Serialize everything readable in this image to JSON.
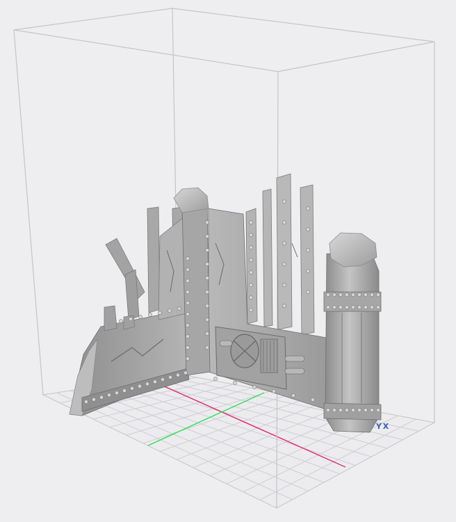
{
  "viewport": {
    "background": "#eeeef0",
    "build_volume_color": "#c4c4c8",
    "grid_color": "#c9c9cf",
    "x_axis_color": "#e0336e",
    "y_axis_color": "#33e05a",
    "model_color": "#9b9b9b",
    "model_highlight": "#c2c2c2",
    "model_shadow": "#6e6e6e",
    "orientation_indicator_color": "#3b5fb0"
  },
  "scene": {
    "model": "ruined-industrial-wall-corner",
    "orientation_indicator_icon": "axis-triad-icon",
    "orientation_glyph": "Y X"
  }
}
